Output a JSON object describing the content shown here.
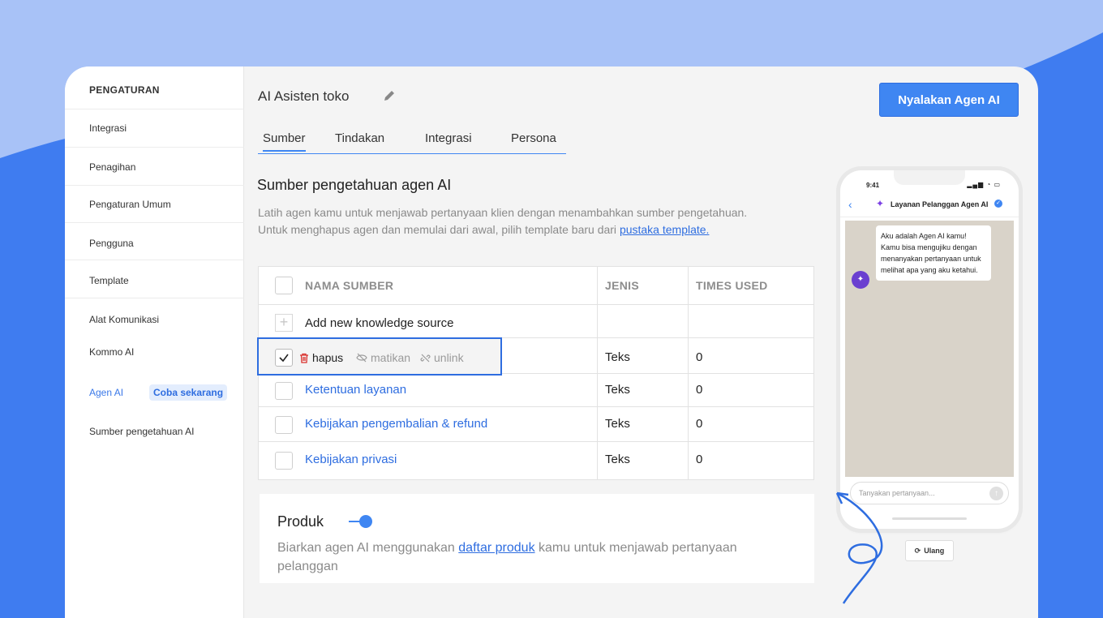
{
  "colors": {
    "accent": "#3f86f2",
    "link": "#2e6de0",
    "bg_light": "#a8c2f7",
    "bg_dark": "#3f7cf0"
  },
  "sidebar": {
    "header": "PENGATURAN",
    "items": [
      {
        "label": "Integrasi"
      },
      {
        "label": "Penagihan"
      },
      {
        "label": "Pengaturan Umum"
      },
      {
        "label": "Pengguna"
      },
      {
        "label": "Template"
      },
      {
        "label": "Alat Komunikasi"
      },
      {
        "label": "Kommo AI"
      },
      {
        "label": "Agen AI"
      },
      {
        "label": "Sumber pengetahuan AI"
      }
    ],
    "badge": "Coba sekarang"
  },
  "header": {
    "title": "AI Asisten toko",
    "cta": "Nyalakan Agen AI"
  },
  "tabs": [
    {
      "label": "Sumber",
      "active": true
    },
    {
      "label": "Tindakan"
    },
    {
      "label": "Integrasi"
    },
    {
      "label": "Persona"
    }
  ],
  "section": {
    "title": "Sumber pengetahuan agen AI",
    "desc_1": "Latih agen kamu untuk menjawab pertanyaan klien dengan menambahkan sumber pengetahuan.",
    "desc_2": "Untuk menghapus agen dan memulai dari awal, pilih template baru dari",
    "desc_link": "pustaka template."
  },
  "table": {
    "headers": [
      "NAMA SUMBER",
      "JENIS",
      "TIMES USED"
    ],
    "add_label": "Add new knowledge source",
    "actions": {
      "delete": "hapus",
      "disable": "matikan",
      "unlink": "unlink"
    },
    "rows": [
      {
        "name": "",
        "type": "Teks",
        "used": "0"
      },
      {
        "name": "Ketentuan layanan",
        "type": "Teks",
        "used": "0"
      },
      {
        "name": "Kebijakan pengembalian & refund",
        "type": "Teks",
        "used": "0"
      },
      {
        "name": "Kebijakan privasi",
        "type": "Teks",
        "used": "0"
      }
    ]
  },
  "produk": {
    "title": "Produk",
    "toggle_on": true,
    "desc_pre": "Biarkan agen AI menggunakan",
    "desc_link": "daftar produk",
    "desc_post": "kamu untuk menjawab pertanyaan pelanggan"
  },
  "phone": {
    "time": "9:41",
    "status_icons": "signal-wifi-battery",
    "chat_name": "Layanan Pelanggan Agen AI",
    "message": "Aku adalah Agen AI kamu! Kamu bisa mengujiku dengan menanyakan pertanyaan untuk melihat apa yang aku ketahui.",
    "input_placeholder": "Tanyakan pertanyaan...",
    "reset_label": "Ulang"
  }
}
